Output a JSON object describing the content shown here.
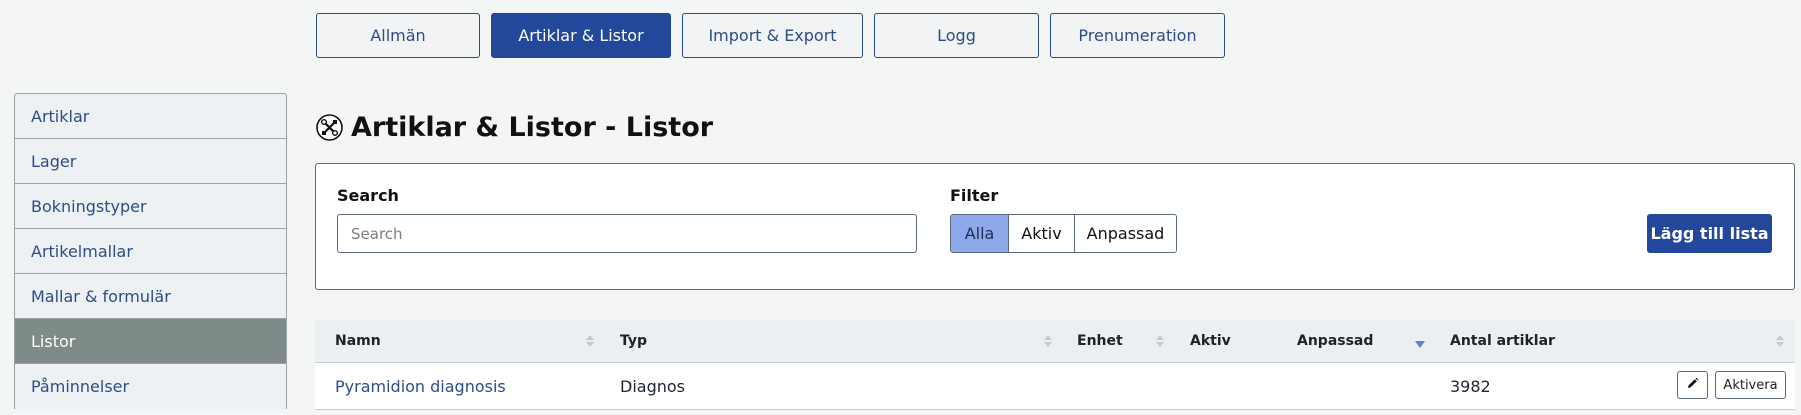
{
  "tabs": [
    {
      "label": "Allmän"
    },
    {
      "label": "Artiklar & Listor"
    },
    {
      "label": "Import & Export"
    },
    {
      "label": "Logg"
    },
    {
      "label": "Prenumeration"
    }
  ],
  "sidebar": {
    "items": [
      {
        "label": "Artiklar"
      },
      {
        "label": "Lager"
      },
      {
        "label": "Bokningstyper"
      },
      {
        "label": "Artikelmallar"
      },
      {
        "label": "Mallar & formulär"
      },
      {
        "label": "Listor"
      },
      {
        "label": "Påminnelser"
      }
    ]
  },
  "page": {
    "title": "Artiklar & Listor - Listor",
    "icon": "tools-icon"
  },
  "search": {
    "label": "Search",
    "placeholder": "Search",
    "value": ""
  },
  "filter": {
    "label": "Filter",
    "options": [
      {
        "label": "Alla"
      },
      {
        "label": "Aktiv"
      },
      {
        "label": "Anpassad"
      }
    ],
    "selected": "Alla"
  },
  "add_button": {
    "label": "Lägg till lista"
  },
  "table": {
    "headers": {
      "namn": "Namn",
      "typ": "Typ",
      "enhet": "Enhet",
      "aktiv": "Aktiv",
      "anpassad": "Anpassad",
      "antal": "Antal artiklar"
    },
    "rows": [
      {
        "namn": "Pyramidion diagnosis",
        "typ": "Diagnos",
        "enhet": "",
        "aktiv": "",
        "anpassad": "",
        "antal": "3982",
        "edit_icon": "pencil-icon",
        "action_label": "Aktivera"
      }
    ]
  },
  "colors": {
    "primary": "#23479b",
    "sidebar_active": "#7e8b88",
    "filter_active": "#8ea8ea",
    "link": "#2c4d87"
  }
}
